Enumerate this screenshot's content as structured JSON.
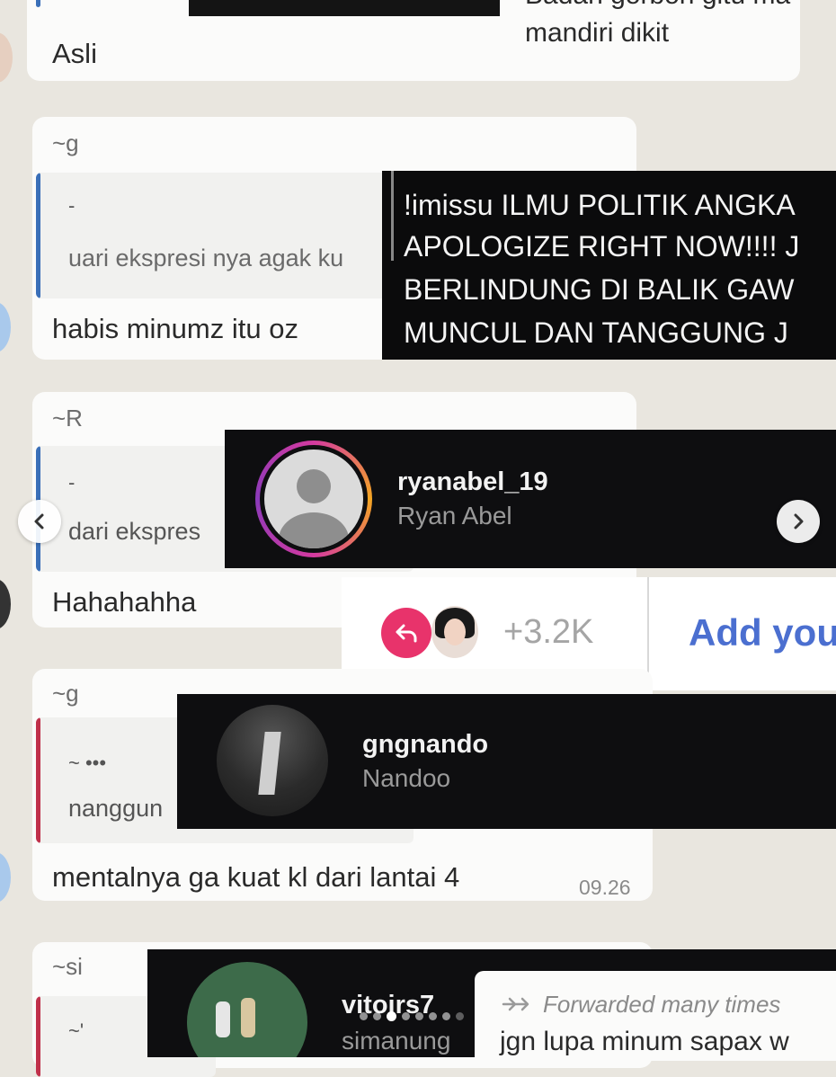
{
  "messages": {
    "m1_text": "Asli",
    "m1_reply_line1": "Badan gorbon gitu ma",
    "m1_reply_line2": "mandiri dikit",
    "m2_sender": "~g",
    "m2_quote_author": "-",
    "m2_quote_text": "uari ekspresi nya agak ku",
    "m2_text": "habis minumz itu oz",
    "m3_sender": "~R",
    "m3_quote_author": "-",
    "m3_quote_text": "dari ekspres",
    "m3_text": "Hahahahha",
    "m4_sender": "~g",
    "m4_quote_author": "~ •••",
    "m4_quote_text": "nanggun",
    "m4_text": "mentalnya ga kuat kl dari lantai 4",
    "m4_time": "09.26",
    "m5_sender": "~si",
    "m5_quote_author": "~'"
  },
  "overlay_post": {
    "lines": [
      "!imissu ILMU POLITIK ANGKA",
      "APOLOGIZE RIGHT NOW!!!! J",
      "BERLINDUNG DI BALIK GAW",
      "MUNCUL DAN TANGGUNG J"
    ]
  },
  "profiles": [
    {
      "username": "ryanabel_19",
      "display_name": "Ryan Abel"
    },
    {
      "username": "gngnando",
      "display_name": "Nandoo"
    },
    {
      "username": "vitojrs7",
      "display_name": "simanung"
    }
  ],
  "reaction_bar": {
    "count": "+3.2K",
    "add_label": "Add you"
  },
  "forwarded": {
    "label": "Forwarded many times",
    "text": "jgn lupa minum sapax w"
  },
  "carousel": {
    "dot_count": 8,
    "active_index": 2
  },
  "colors": {
    "chat_bg": "#e9e6df",
    "bubble": "#fbfbfa",
    "quote_bar_blue": "#3a6fb8",
    "quote_bar_red": "#c0304a",
    "reply_pink": "#e8336b",
    "add_blue": "#4b6fd0"
  }
}
